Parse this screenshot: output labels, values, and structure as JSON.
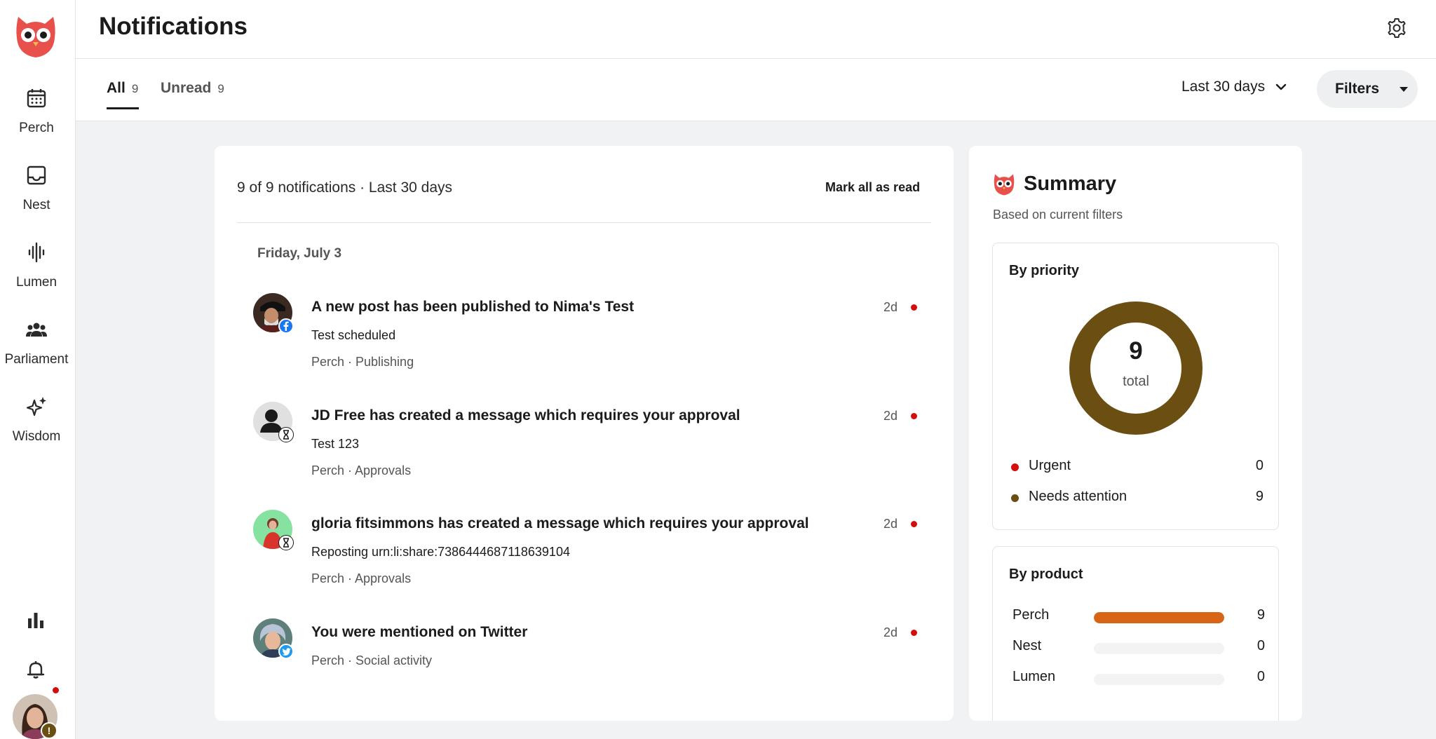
{
  "sidebar": {
    "items": [
      {
        "label": "Perch",
        "icon": "calendar-icon"
      },
      {
        "label": "Nest",
        "icon": "inbox-icon"
      },
      {
        "label": "Lumen",
        "icon": "waveform-icon"
      },
      {
        "label": "Parliament",
        "icon": "group-icon"
      },
      {
        "label": "Wisdom",
        "icon": "sparkles-icon"
      }
    ],
    "bottom": [
      {
        "icon": "analytics-icon"
      },
      {
        "icon": "bell-icon"
      }
    ],
    "avatar_badge": "!"
  },
  "header": {
    "title": "Notifications"
  },
  "tabs": [
    {
      "label": "All",
      "count": "9"
    },
    {
      "label": "Unread",
      "count": "9"
    }
  ],
  "toolbar": {
    "range_label": "Last 30 days",
    "filters_label": "Filters"
  },
  "list": {
    "summary": "9 of 9 notifications · Last 30 days",
    "mark_all_label": "Mark all as read",
    "date_heading": "Friday, July 3",
    "items": [
      {
        "title": "A new post has been published to Nima's Test",
        "body": "Test scheduled",
        "meta": "Perch · Publishing",
        "time": "2d",
        "badge": "facebook-icon"
      },
      {
        "title": "JD Free has created a message which requires your approval",
        "body": "Test 123",
        "meta": "Perch · Approvals",
        "time": "2d",
        "badge": "hourglass-icon"
      },
      {
        "title": "gloria fitsimmons has created a message which requires your approval",
        "body": "Reposting urn:li:share:7386444687118639104",
        "meta": "Perch · Approvals",
        "time": "2d",
        "badge": "hourglass-icon"
      },
      {
        "title": "You were mentioned on Twitter",
        "body": "",
        "meta": "Perch · Social activity",
        "time": "2d",
        "badge": "twitter-icon"
      }
    ]
  },
  "summary": {
    "title": "Summary",
    "subtitle": "Based on current filters",
    "priority": {
      "title": "By priority",
      "total": "9",
      "total_label": "total",
      "rows": [
        {
          "label": "Urgent",
          "value": "0",
          "color": "#d40c0c"
        },
        {
          "label": "Needs attention",
          "value": "9",
          "color": "#6b4e12"
        }
      ]
    },
    "product": {
      "title": "By product",
      "rows": [
        {
          "label": "Perch",
          "value": "9",
          "fraction": 1.0
        },
        {
          "label": "Nest",
          "value": "0",
          "fraction": 0
        },
        {
          "label": "Lumen",
          "value": "0",
          "fraction": 0
        }
      ]
    }
  },
  "colors": {
    "brand": "#e8514b",
    "accent_bar": "#d86515",
    "donut": "#6b4e12",
    "unread_dot": "#d40c0c"
  }
}
